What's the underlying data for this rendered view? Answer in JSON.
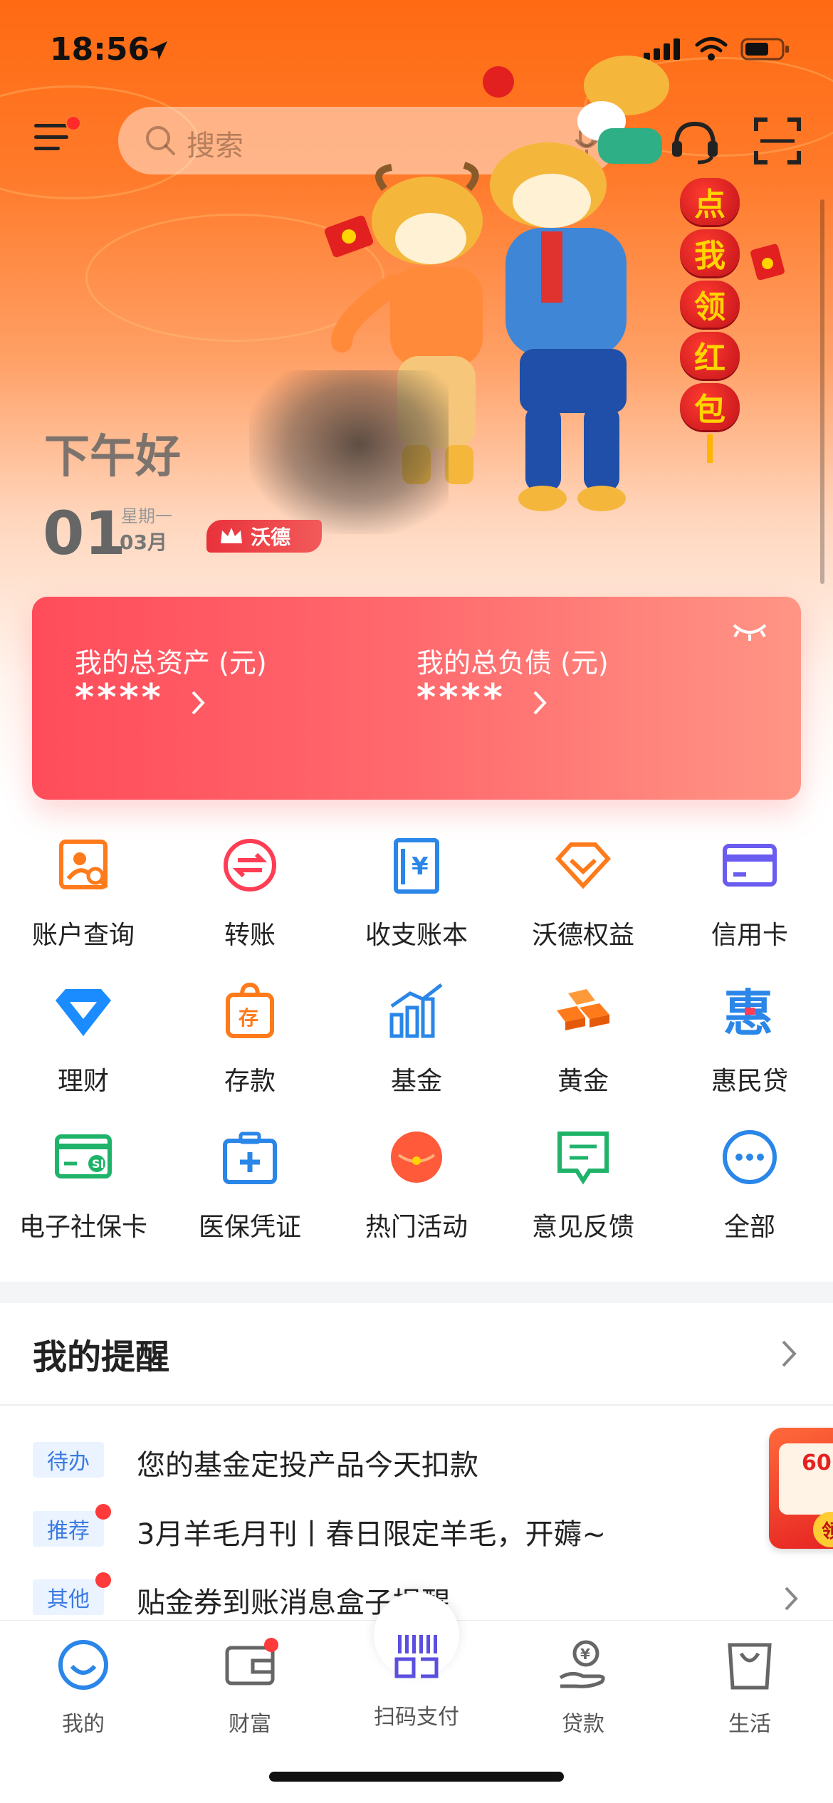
{
  "status_bar": {
    "time": "18:56"
  },
  "header": {
    "search_placeholder": "搜索"
  },
  "banner": {
    "greeting": "下午好",
    "day": "01",
    "weekday": "星期一",
    "month": "03月",
    "vip_label": "沃德",
    "lantern_chars": [
      "点",
      "我",
      "领",
      "红",
      "包"
    ]
  },
  "assets": {
    "total_assets_label": "我的总资产 (元)",
    "total_assets_value": "****",
    "total_debt_label": "我的总负债 (元)",
    "total_debt_value": "****"
  },
  "grid": [
    {
      "label": "账户查询",
      "icon": "account-query-icon",
      "color": "#ff7a1a"
    },
    {
      "label": "转账",
      "icon": "transfer-icon",
      "color": "#ff3d54"
    },
    {
      "label": "收支账本",
      "icon": "ledger-icon",
      "color": "#2a86e8"
    },
    {
      "label": "沃德权益",
      "icon": "diamond-benefit-icon",
      "color": "#ff7a1a"
    },
    {
      "label": "信用卡",
      "icon": "credit-card-icon",
      "color": "#6a5cf0"
    },
    {
      "label": "理财",
      "icon": "wealth-diamond-icon",
      "color": "#1a8cff"
    },
    {
      "label": "存款",
      "icon": "deposit-bag-icon",
      "color": "#ff7a1a"
    },
    {
      "label": "基金",
      "icon": "fund-chart-icon",
      "color": "#2a86e8"
    },
    {
      "label": "黄金",
      "icon": "gold-bars-icon",
      "color": "#ff7a1a"
    },
    {
      "label": "惠民贷",
      "icon": "huimin-loan-icon",
      "color": "#2a86e8"
    },
    {
      "label": "电子社保卡",
      "icon": "social-security-card-icon",
      "color": "#1fb36a"
    },
    {
      "label": "医保凭证",
      "icon": "medical-insurance-icon",
      "color": "#2a86e8"
    },
    {
      "label": "热门活动",
      "icon": "red-envelope-icon",
      "color": "#ff5a3a"
    },
    {
      "label": "意见反馈",
      "icon": "feedback-icon",
      "color": "#1fb36a"
    },
    {
      "label": "全部",
      "icon": "more-dots-icon",
      "color": "#2a86e8"
    }
  ],
  "reminders": {
    "title": "我的提醒",
    "items": [
      {
        "tag": "待办",
        "text": "您的基金定投产品今天扣款"
      },
      {
        "tag": "推荐",
        "text": "3月羊毛月刊丨春日限定羊毛，开薅~"
      },
      {
        "tag": "其他",
        "text": "贴金券到账消息盒子提醒"
      }
    ],
    "promo_number": "60",
    "promo_button": "领"
  },
  "tabbar": [
    {
      "label": "我的",
      "icon": "smile-icon"
    },
    {
      "label": "财富",
      "icon": "wallet-icon"
    },
    {
      "label": "扫码支付",
      "icon": "scan-pay-icon"
    },
    {
      "label": "贷款",
      "icon": "loan-hand-icon"
    },
    {
      "label": "生活",
      "icon": "shopping-bag-icon"
    }
  ]
}
